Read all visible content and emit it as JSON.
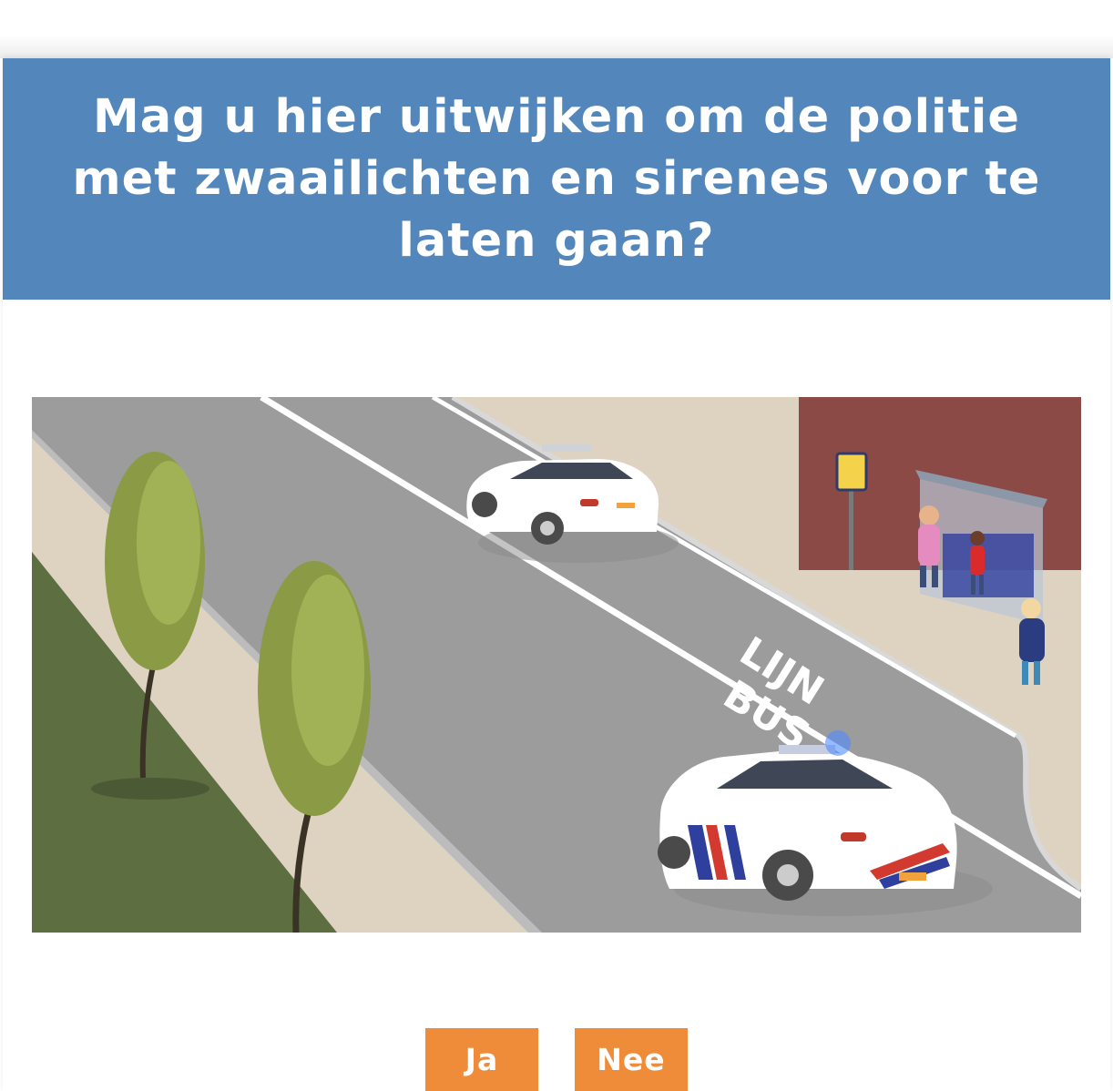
{
  "question": {
    "text": "Mag u hier uitwijken om de politie met zwaailichten en sirenes voor te laten gaan?"
  },
  "illustration": {
    "road_marking_line1": "LIJN",
    "road_marking_line2": "BUS"
  },
  "answers": [
    {
      "label": "Ja"
    },
    {
      "label": "Nee"
    }
  ],
  "colors": {
    "header": "#5386ba",
    "button": "#ef8c3a"
  }
}
